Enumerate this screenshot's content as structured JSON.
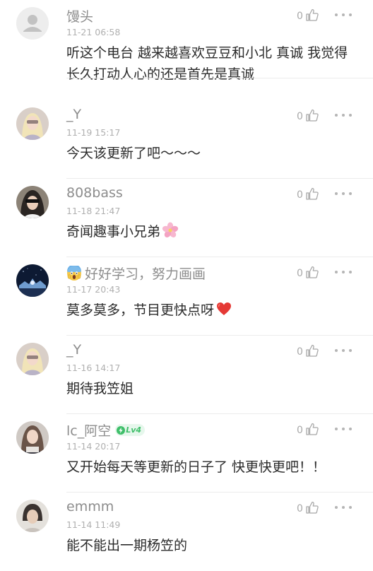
{
  "comments": [
    {
      "username": "馒头",
      "time": "11-21 06:58",
      "text": "听这个电台 越来越喜欢豆豆和小北 真诚 我觉得长久打动人心的还是首先是真诚",
      "likes": "0",
      "avatar": "default-avatar"
    },
    {
      "username": "_Y",
      "time": "11-19 15:17",
      "text": "今天该更新了吧～～～",
      "likes": "0",
      "avatar": "photo-avatar"
    },
    {
      "username": "808bass",
      "time": "11-18 21:47",
      "text": "奇闻趣事小兄弟",
      "likes": "0",
      "avatar": "photo-avatar",
      "icon": "cherry-blossom-icon"
    },
    {
      "username": "好好学习，努力画画",
      "time": "11-17 20:43",
      "text": "莫多莫多，节目更快点呀",
      "likes": "0",
      "avatar": "photo-avatar",
      "username_icon": "screaming-face-icon",
      "icon": "red-heart-icon"
    },
    {
      "username": "_Y",
      "time": "11-16 14:17",
      "text": "期待我笠姐",
      "likes": "0",
      "avatar": "photo-avatar"
    },
    {
      "username": "lc_阿空",
      "time": "11-14 20:17",
      "text": "又开始每天等更新的日子了 快更快更吧！！",
      "likes": "0",
      "avatar": "photo-avatar",
      "badge": "Lv4"
    },
    {
      "username": "emmm",
      "time": "11-14 11:49",
      "text": "能不能出一期杨笠的",
      "likes": "0",
      "avatar": "photo-avatar"
    }
  ],
  "colors": {
    "username": "#8d8d8d",
    "timestamp": "#b0b0b0",
    "text": "#2b2b2b",
    "badge_green": "#3fbf6a",
    "heart_red": "#e53935"
  }
}
